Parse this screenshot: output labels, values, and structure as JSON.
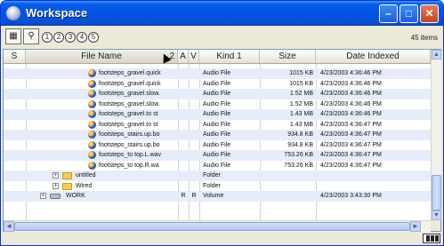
{
  "window": {
    "title": "Workspace",
    "minimize_glyph": "–",
    "maximize_glyph": "□",
    "close_glyph": "✕"
  },
  "toolbar": {
    "tools": [
      {
        "name": "workspace-tool-icon",
        "glyph": "▦"
      },
      {
        "name": "search-tool-icon",
        "glyph": "⚲"
      }
    ],
    "markers": [
      "1",
      "2",
      "3",
      "4",
      "5"
    ],
    "items_count": "45 items"
  },
  "columns": {
    "s": "S",
    "file_name": "File Name",
    "sort_index": "2",
    "a": "A",
    "v": "V",
    "kind": "Kind",
    "kind_sort_index": "1",
    "size": "Size",
    "date": "Date Indexed"
  },
  "rows": [
    {
      "type": "file",
      "name": "footsteps_gravel.quick",
      "a": "",
      "v": "",
      "kind": "Audio File",
      "size": "1015 KB",
      "date": "4/23/2003 4:36:46 PM"
    },
    {
      "type": "file",
      "name": "footsteps_gravel.quick",
      "a": "",
      "v": "",
      "kind": "Audio File",
      "size": "1015 KB",
      "date": "4/23/2003 4:36:46 PM"
    },
    {
      "type": "file",
      "name": "footsteps_gravel.slow.",
      "a": "",
      "v": "",
      "kind": "Audio File",
      "size": "1.52 MB",
      "date": "4/23/2003 4:36:46 PM"
    },
    {
      "type": "file",
      "name": "footsteps_gravel.slow.",
      "a": "",
      "v": "",
      "kind": "Audio File",
      "size": "1.52 MB",
      "date": "4/23/2003 4:36:46 PM"
    },
    {
      "type": "file",
      "name": "footsteps_gravel.to st",
      "a": "",
      "v": "",
      "kind": "Audio File",
      "size": "1.43 MB",
      "date": "4/23/2003 4:36:46 PM"
    },
    {
      "type": "file",
      "name": "footsteps_gravel.to st",
      "a": "",
      "v": "",
      "kind": "Audio File",
      "size": "1.43 MB",
      "date": "4/23/2003 4:36:47 PM"
    },
    {
      "type": "file",
      "name": "footsteps_stairs.up.bo",
      "a": "",
      "v": "",
      "kind": "Audio File",
      "size": "934.8 KB",
      "date": "4/23/2003 4:36:47 PM"
    },
    {
      "type": "file",
      "name": "footsteps_stairs.up.bo",
      "a": "",
      "v": "",
      "kind": "Audio File",
      "size": "934.8 KB",
      "date": "4/23/2003 4:36:47 PM"
    },
    {
      "type": "file",
      "name": "footsteps_to top.L.wav",
      "a": "",
      "v": "",
      "kind": "Audio File",
      "size": "753.26 KB",
      "date": "4/23/2003 4:36:47 PM"
    },
    {
      "type": "file",
      "name": "footsteps_to top.R.wa",
      "a": "",
      "v": "",
      "kind": "Audio File",
      "size": "753.26 KB",
      "date": "4/23/2003 4:36:47 PM"
    },
    {
      "type": "folder",
      "name": "untitled",
      "a": "",
      "v": "",
      "kind": "Folder",
      "size": "",
      "date": ""
    },
    {
      "type": "folder",
      "name": "Wired",
      "a": "",
      "v": "",
      "kind": "Folder",
      "size": "",
      "date": ""
    },
    {
      "type": "volume",
      "name": "WORK",
      "a": "R",
      "v": "R",
      "kind": "Volume",
      "size": "",
      "date": "4/23/2003 3:43:30 PM"
    }
  ],
  "scroll": {
    "up_glyph": "▲",
    "down_glyph": "▼",
    "left_glyph": "◄",
    "right_glyph": "►"
  }
}
